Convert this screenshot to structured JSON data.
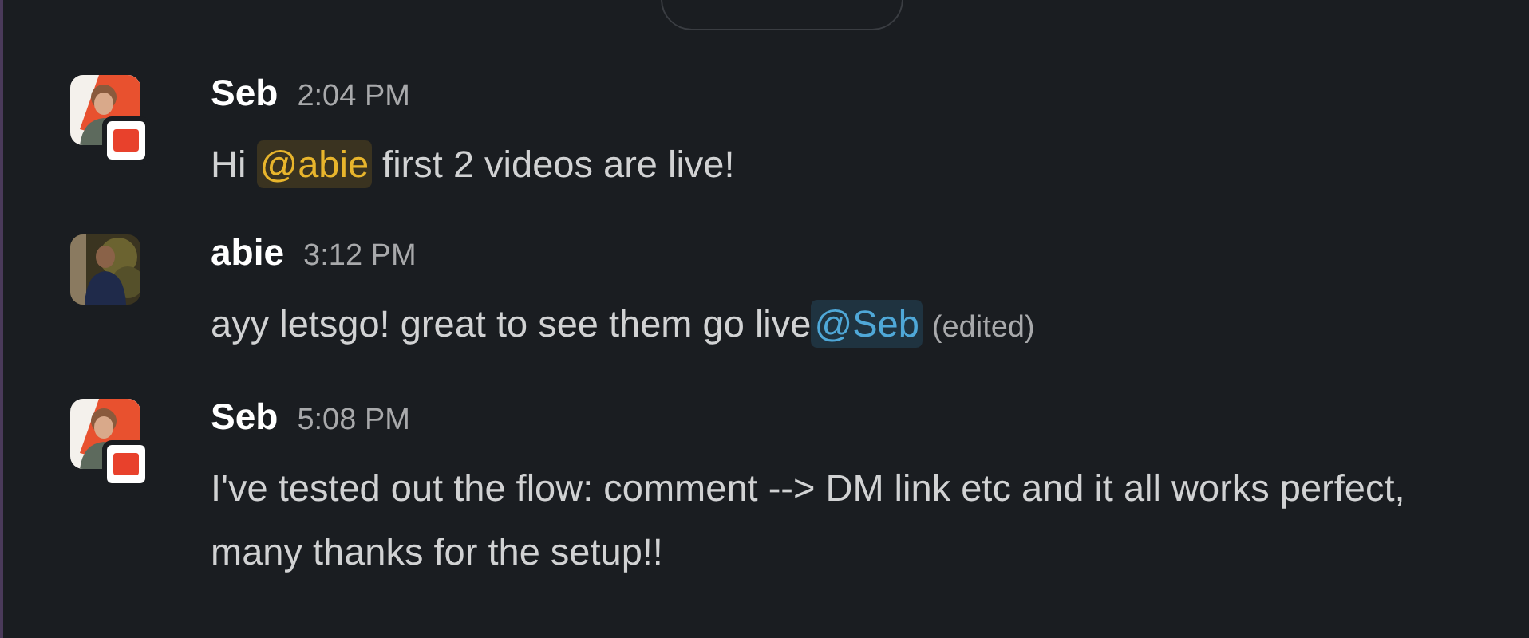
{
  "messages": [
    {
      "sender": "Seb",
      "time": "2:04 PM",
      "avatar": {
        "kind": "picture",
        "org_badge": true
      },
      "parts": [
        {
          "kind": "text",
          "text": "Hi "
        },
        {
          "kind": "self_mention",
          "text": "@abie"
        },
        {
          "kind": "text",
          "text": " first 2 videos are live!"
        }
      ]
    },
    {
      "sender": "abie",
      "time": "3:12 PM",
      "avatar": {
        "kind": "picture",
        "org_badge": false
      },
      "parts": [
        {
          "kind": "text",
          "text": "ayy letsgo! great to see them go live"
        },
        {
          "kind": "mention",
          "text": "@Seb"
        },
        {
          "kind": "edited",
          "text": "(edited)"
        }
      ]
    },
    {
      "sender": "Seb",
      "time": "5:08 PM",
      "avatar": {
        "kind": "picture",
        "org_badge": true
      },
      "parts": [
        {
          "kind": "text",
          "text": "I've tested out the flow: comment --> DM link etc and it all works perfect, many thanks for the setup!!"
        }
      ]
    }
  ]
}
